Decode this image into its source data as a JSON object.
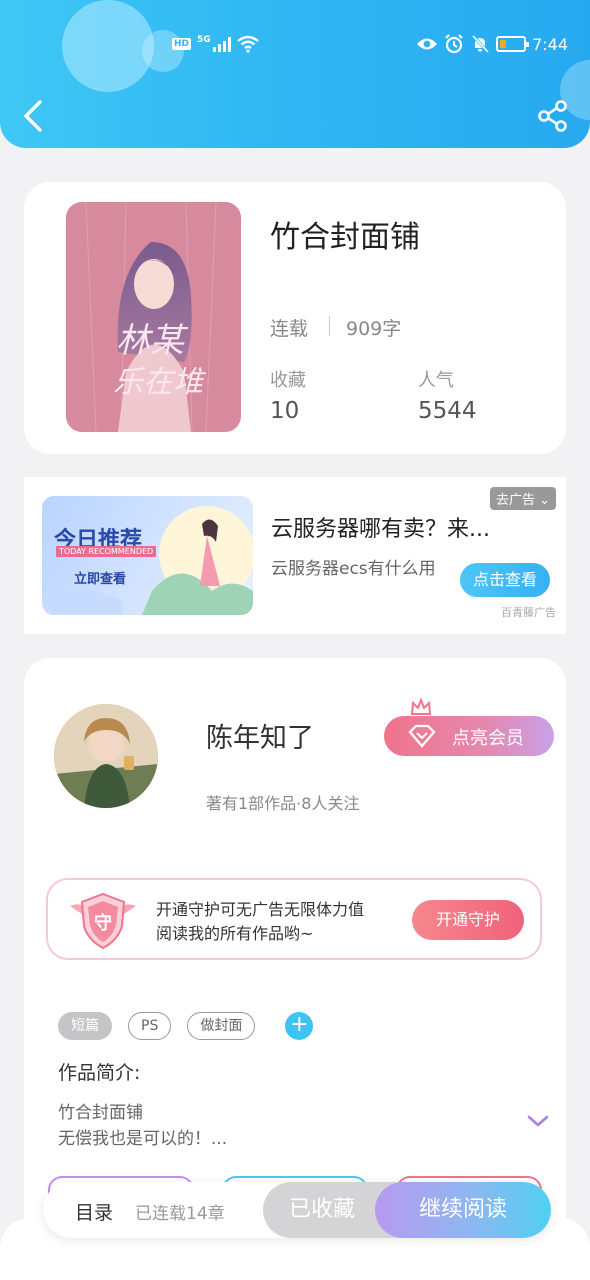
{
  "status_bar": {
    "time": "7:44",
    "hd": "HD",
    "network": "5G"
  },
  "book": {
    "title": "竹合封面铺",
    "status": "连载",
    "word_count": "909字",
    "stats": [
      {
        "label": "收藏",
        "value": "10"
      },
      {
        "label": "人气",
        "value": "5544"
      }
    ],
    "cover_text": "林某人 乐在堆"
  },
  "ad": {
    "tag": "去广告",
    "title": "云服务器哪有卖？来...",
    "description": "云服务器ecs有什么用",
    "button": "点击查看",
    "source": "百青藤广告",
    "image_title": "今日推荐",
    "image_subtitle": "TODAY RECOMMENDED",
    "image_cta": "立即查看"
  },
  "author": {
    "name": "陈年知了",
    "meta": "著有1部作品·8人关注",
    "vip_button": "点亮会员",
    "guard_badge": "守",
    "guard_text_line1": "开通守护可无广告无限体力值",
    "guard_text_line2": "阅读我的所有作品哟~",
    "guard_button": "开通守护",
    "tags": [
      "短篇",
      "PS",
      "做封面"
    ],
    "add_tag": "+",
    "intro_label": "作品简介:",
    "intro_line1": "竹合封面铺",
    "intro_line2": "无偿我也是可以的！..."
  },
  "bottom_bar": {
    "toc_label": "目录",
    "toc_count": "已连载14章",
    "favorite_button": "已收藏",
    "read_button": "继续阅读"
  },
  "colors": {
    "header": "#2fb6f2",
    "accent_blue": "#3dc4f2",
    "vip_pink": "#f0748b"
  }
}
